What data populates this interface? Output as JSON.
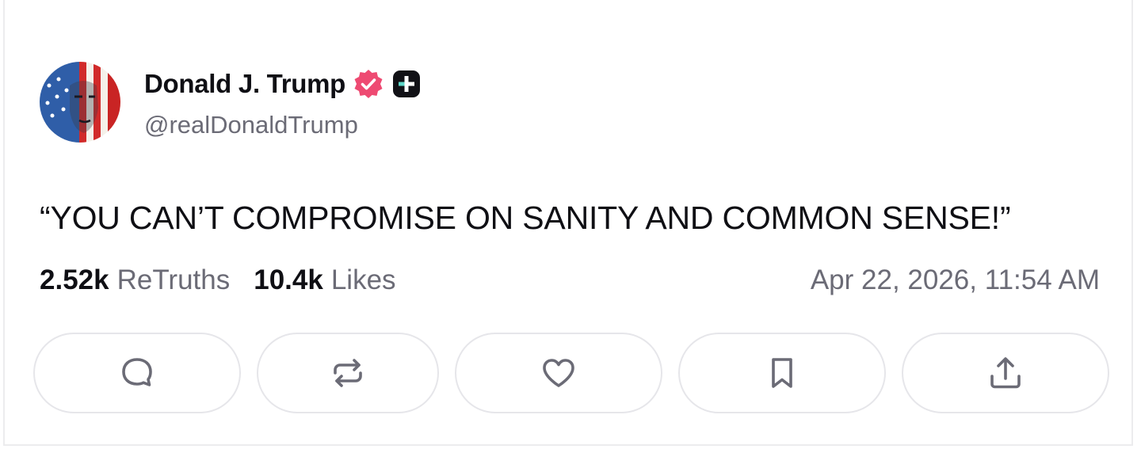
{
  "author": {
    "display_name": "Donald J. Trump",
    "handle": "@realDonaldTrump",
    "avatar_icon": "flag-portrait-avatar",
    "verified_icon": "verified-badge-icon",
    "plus_icon": "plus-badge-icon"
  },
  "post": {
    "text": "“YOU CAN’T COMPROMISE ON SANITY AND COMMON SENSE!”"
  },
  "stats": {
    "retruths_count": "2.52k",
    "retruths_label": "ReTruths",
    "likes_count": "10.4k",
    "likes_label": "Likes",
    "timestamp": "Apr 22, 2026, 11:54 AM"
  },
  "actions": [
    {
      "name": "reply",
      "icon": "comment-icon"
    },
    {
      "name": "retruth",
      "icon": "repost-icon"
    },
    {
      "name": "like",
      "icon": "heart-icon"
    },
    {
      "name": "bookmark",
      "icon": "bookmark-icon"
    },
    {
      "name": "share",
      "icon": "share-icon"
    }
  ],
  "colors": {
    "verified": "#ee4a72",
    "text_primary": "#0f0f14",
    "text_secondary": "#6b6b76",
    "icon": "#6b6b76",
    "border": "#e6e6ea"
  }
}
